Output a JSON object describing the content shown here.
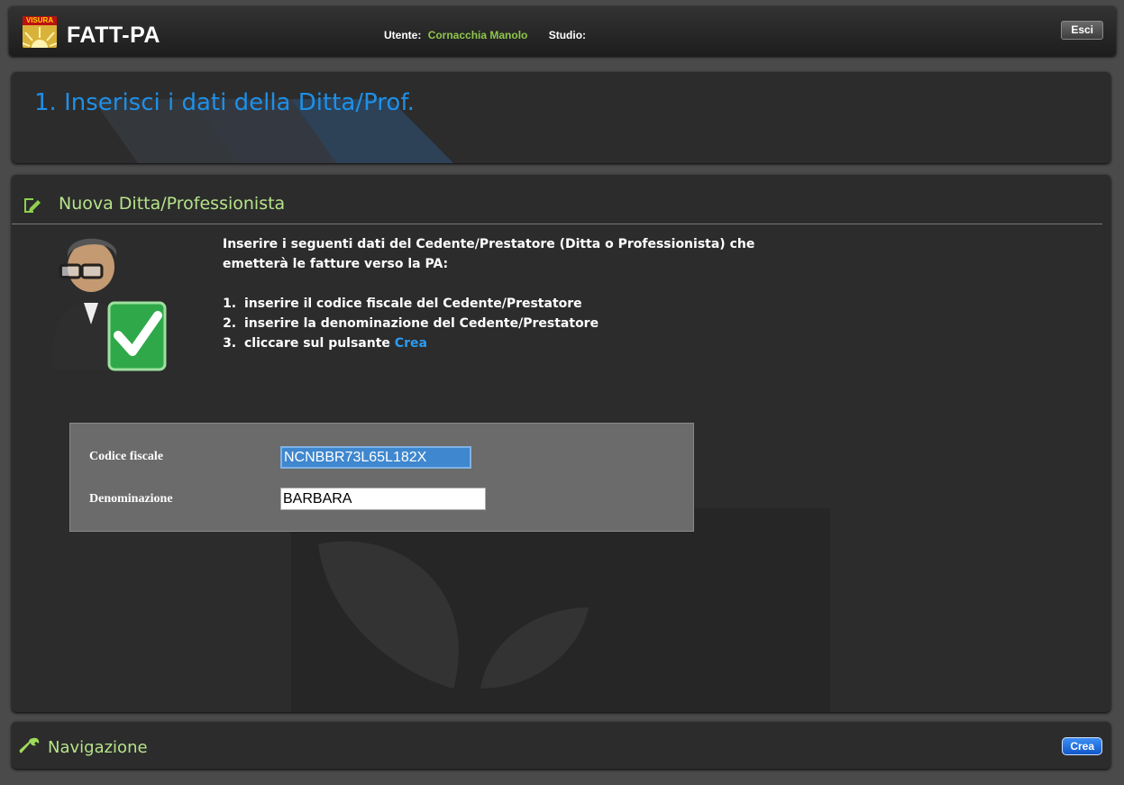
{
  "header": {
    "logo_text": "VISURA",
    "app_title": "FATT-PA",
    "user_label": "Utente:",
    "user_name": "Cornacchia Manolo",
    "studio_label": "Studio:",
    "exit_label": "Esci"
  },
  "step": {
    "title": "1. Inserisci i dati della Ditta/Prof."
  },
  "section": {
    "title": "Nuova Ditta/Professionista",
    "icon": "edit-icon",
    "intro": "Inserire i seguenti dati del Cedente/Prestatore (Ditta o Professionista) che emetterà le fatture verso la PA:",
    "steps": [
      "inserire il codice fiscale del Cedente/Prestatore",
      "inserire la denominazione del Cedente/Prestatore",
      "cliccare sul pulsante "
    ],
    "steps_highlight": "Crea"
  },
  "form": {
    "codice_fiscale_label": "Codice fiscale",
    "codice_fiscale_value": "NCNBBR73L65L182X",
    "denominazione_label": "Denominazione",
    "denominazione_value": "BARBARA"
  },
  "navigation": {
    "title": "Navigazione",
    "icon": "wrench-icon",
    "create_label": "Crea"
  },
  "colors": {
    "accent_blue": "#1e90e8",
    "accent_green": "#b6e38a",
    "user_green": "#8fc64a",
    "panel_bg": "#2c2c2c"
  }
}
